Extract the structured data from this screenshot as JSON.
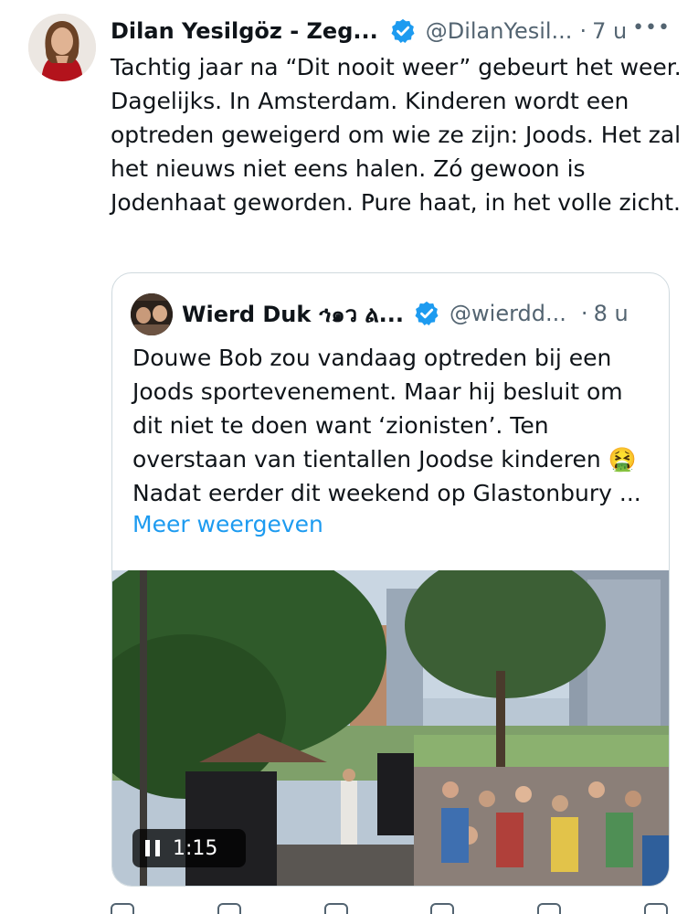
{
  "author": {
    "name": "Dilan Yesilgöz - Zeg...",
    "handle": "@DilanYesil...",
    "separator": "·",
    "time": "7 u",
    "more": "•••"
  },
  "tweet": {
    "text": "Tachtig jaar na “Dit nooit weer” gebeurt het weer. Dagelijks. In Amsterdam. Kinderen wordt een optreden geweigerd om wie ze zijn: Joods. Het zal het nieuws niet eens halen. Zó gewoon is Jodenhaat geworden. Pure haat, in het volle zicht."
  },
  "quote": {
    "name": "Wierd Duk ኅ๑ว ል...",
    "handle": "@wierdd...",
    "separator": "·",
    "time": "8 u",
    "text": "Douwe Bob zou vandaag optreden bij een Joods sportevenement. Maar hij besluit om dit niet te doen want ‘zionisten’. Ten overstaan van tientallen Joodse kinderen 🤮 Nadat eerder dit weekend op Glastonbury ...",
    "show_more": "Meer weergeven",
    "video_time": "1:15"
  },
  "colors": {
    "accent": "#1d9bf0",
    "secondary_text": "#536471",
    "border": "#cfd9de"
  },
  "icons": [
    "verified-badge-icon",
    "more-icon",
    "pause-icon"
  ]
}
